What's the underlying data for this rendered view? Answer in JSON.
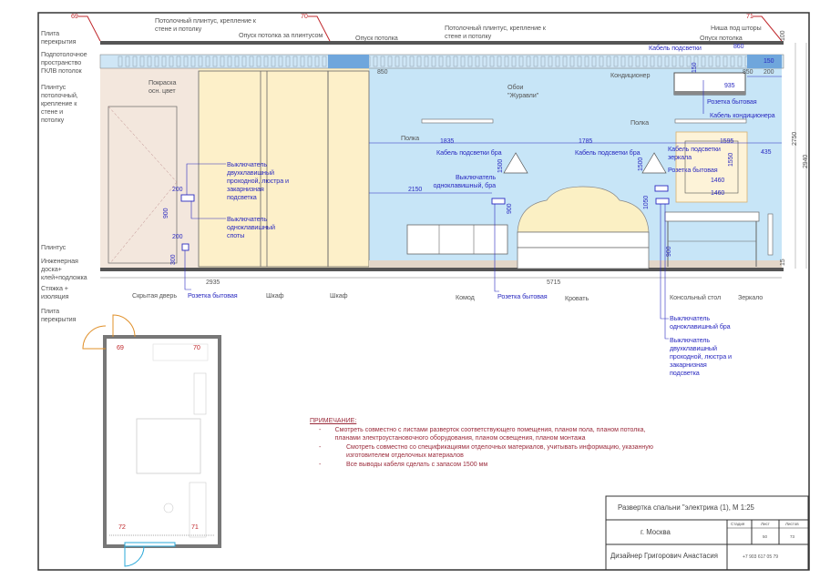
{
  "markers": {
    "m69": "69",
    "m70": "70",
    "m71": "71",
    "p69": "69",
    "p70": "70",
    "p71": "71",
    "p72": "72"
  },
  "left_labels": {
    "slab_top": "Плита перекрытия",
    "subceiling": "Подпотолочное пространство",
    "gklv": "ГКЛВ потолок",
    "ceiling_plinth": "Плинтус потолочный, крепление к стене и потолку",
    "plinth": "Плинтус",
    "eng_board": "Инженерная доска+ клей+подложка",
    "screed": "Стяжка + изоляция",
    "slab_bottom": "Плита перекрытия"
  },
  "top_labels": {
    "plinth_1": "Потолочный плинтус, крепление к стене и потолку",
    "drop_behind_plinth": "Опуск потолка за плинтусом",
    "drop_1": "Опуск потолка",
    "plinth_2": "Потолочный плинтус, крепление к стене и потолку",
    "curtain_niche": "Ниша под шторы",
    "drop_2": "Опуск потолка"
  },
  "wall_labels": {
    "paint": "Покраска осн. цвет",
    "wallpaper": "Обои \"Журавли\"",
    "ac": "Кондиционер",
    "shelf_1": "Полка",
    "shelf_2": "Полка"
  },
  "electric_labels": {
    "light_cable": "Кабель подсветки",
    "socket_ac": "Розетка бытовая",
    "ac_cable": "Кабель кондиционера",
    "sconce_cable_1": "Кабель подсветки бра",
    "sconce_cable_2": "Кабель подсветки бра",
    "mirror_cable": "Кабель подсветки зеркала",
    "socket_mirror": "Розетка бытовая",
    "switch_sconce_1": "Выключатель одноклавишный, бра",
    "switch_double_1": "Выключатель двухклавишный проходной, люстра и закарнизная подсветка",
    "switch_spots": "Выключатель одноклавишный споты",
    "switch_sconce_2": "Выключатель одноклавишный бра",
    "switch_double_2": "Выключатель двухклавишный проходной, люстра и закарнизная подсветка"
  },
  "bottom_labels": {
    "hidden_door": "Скрытая дверь",
    "socket_1": "Розетка бытовая",
    "wardrobe_1": "Шкаф",
    "wardrobe_2": "Шкаф",
    "dresser": "Комод",
    "socket_2": "Розетка бытовая",
    "bed": "Кровать",
    "console": "Консольный стол",
    "mirror": "Зеркало"
  },
  "dimensions": {
    "d2935": "2935",
    "d5715": "5715",
    "d850a": "850",
    "d850b": "850",
    "d860": "860",
    "d935": "935",
    "d200a": "200",
    "d150": "150",
    "d1835": "1835",
    "d1785": "1785",
    "d2150": "2150",
    "d1595": "1595",
    "d435": "435",
    "d1460a": "1460",
    "d1460b": "1460",
    "d2750": "2750",
    "d2940": "2940",
    "d100": "100",
    "d15": "15",
    "d900a": "900",
    "d200b": "200",
    "d200c": "200",
    "d300": "300",
    "d1500a": "1500",
    "d1500b": "1500",
    "d900b": "900",
    "d1050": "1050",
    "d900c": "900",
    "d1550": "1550",
    "d150b": "150"
  },
  "notes": {
    "title": "ПРИМЕЧАНИЕ:",
    "items": [
      "Смотреть совместно с листами разверток соответствующего помещения, планом пола, планом потолка, планами электроустановочного оборудования, планом освещения, планом монтажа",
      "Смотреть совместно со спецификациями отделочных материалов, учитывать информацию, указанную изготовителем отделочных материалов",
      "Все выводы кабеля сделать с запасом 1500 мм"
    ]
  },
  "title_block": {
    "title": "Развертка спальни \"электрика (1), М 1:25",
    "city": "г. Москва",
    "stage_label": "Стадия",
    "sheet_label": "Лист",
    "sheets_label": "Листов",
    "stage": "",
    "sheet": "50",
    "sheets": "73",
    "designer": "Дизайнер Григорович Анастасия",
    "phone": "+7 903 617 05 79"
  },
  "colors": {
    "wall_blue": "#c7e5f7",
    "wardrobe": "#fdf0c9",
    "paint": "#f3e7dd",
    "electric": "#2a2ac0",
    "marker": "#c0282c",
    "door": "#e0902a",
    "window": "#2aa8d8"
  }
}
